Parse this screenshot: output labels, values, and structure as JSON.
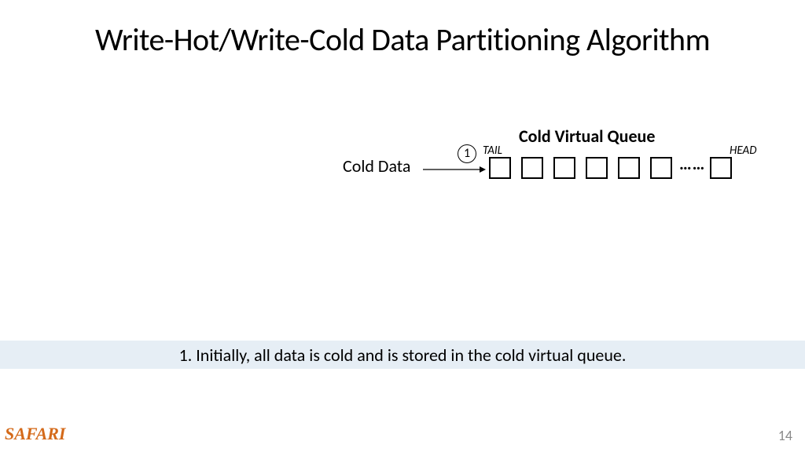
{
  "title": "Write-Hot/Write-Cold Data Partitioning Algorithm",
  "queue": {
    "title": "Cold Virtual Queue",
    "label": "Cold Data",
    "step": "1",
    "tail": "TAIL",
    "head": "HEAD",
    "dots": "……"
  },
  "caption": "1. Initially, all data is cold and is stored in the cold virtual queue.",
  "footer": {
    "logo": "SAFARI",
    "page": "14"
  }
}
